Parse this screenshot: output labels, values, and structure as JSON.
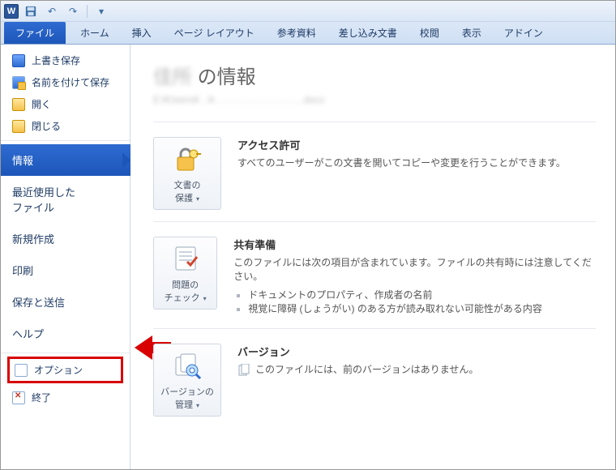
{
  "titlebar": {
    "app_glyph": "W"
  },
  "ribbon": {
    "file": "ファイル",
    "tabs": [
      "ホーム",
      "挿入",
      "ページ レイアウト",
      "参考資料",
      "差し込み文書",
      "校閲",
      "表示",
      "アドイン"
    ]
  },
  "sidebar": {
    "top_items": [
      {
        "label": "上書き保存",
        "icon": "save"
      },
      {
        "label": "名前を付けて保存",
        "icon": "saveas"
      },
      {
        "label": "開く",
        "icon": "folder"
      },
      {
        "label": "閉じる",
        "icon": "folder"
      }
    ],
    "mid_items": [
      {
        "label": "情報",
        "active": true
      },
      {
        "label": "最近使用した\nファイル"
      },
      {
        "label": "新規作成"
      },
      {
        "label": "印刷"
      },
      {
        "label": "保存と送信"
      },
      {
        "label": "ヘルプ"
      }
    ],
    "highlight_item": {
      "label": "オプション",
      "icon": "doc"
    },
    "exit_item": {
      "label": "終了",
      "icon": "exit"
    }
  },
  "content": {
    "title_lead_obscured": "佳所",
    "title_suffix": " の情報",
    "path_obscured": "E:¥Users¥…¥……………………….docx",
    "sections": [
      {
        "tile_label": "文書の\n保護",
        "heading": "アクセス許可",
        "body": "すべてのユーザーがこの文書を開いてコピーや変更を行うことができます。",
        "bullets": [],
        "has_dropdown": true
      },
      {
        "tile_label": "問題の\nチェック",
        "heading": "共有準備",
        "body": "このファイルには次の項目が含まれています。ファイルの共有時には注意してください。",
        "bullets": [
          "ドキュメントのプロパティ、作成者の名前",
          "視覚に障碍 (しょうがい) のある方が読み取れない可能性がある内容"
        ],
        "has_dropdown": true
      },
      {
        "tile_label": "バージョンの\n管理",
        "heading": "バージョン",
        "body": "このファイルには、前のバージョンはありません。",
        "bullets": [],
        "has_dropdown": true,
        "body_has_icon": true
      }
    ]
  }
}
